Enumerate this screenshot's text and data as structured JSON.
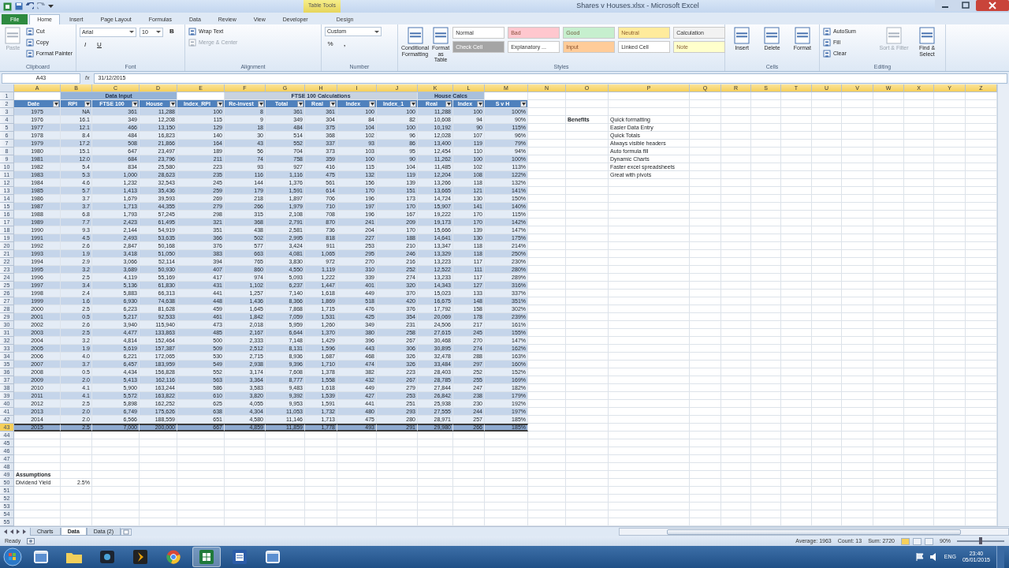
{
  "window": {
    "title": "Shares v Houses.xlsx - Microsoft Excel",
    "contextual_tab": "Table Tools"
  },
  "ribbon": {
    "tabs": [
      {
        "label": "File",
        "kind": "file",
        "selected": false
      },
      {
        "label": "Home",
        "kind": "tab",
        "selected": true
      },
      {
        "label": "Insert",
        "kind": "tab",
        "selected": false
      },
      {
        "label": "Page Layout",
        "kind": "tab",
        "selected": false
      },
      {
        "label": "Formulas",
        "kind": "tab",
        "selected": false
      },
      {
        "label": "Data",
        "kind": "tab",
        "selected": false
      },
      {
        "label": "Review",
        "kind": "tab",
        "selected": false
      },
      {
        "label": "View",
        "kind": "tab",
        "selected": false
      },
      {
        "label": "Developer",
        "kind": "tab",
        "selected": false
      },
      {
        "label": "Design",
        "kind": "contextual",
        "selected": false
      }
    ],
    "groups": [
      {
        "label": "Clipboard",
        "items": [
          {
            "kind": "large",
            "label": "Paste",
            "disabled": true
          },
          {
            "kind": "small",
            "label": "Cut",
            "disabled": false
          },
          {
            "kind": "small",
            "label": "Copy",
            "disabled": false
          },
          {
            "kind": "small",
            "label": "Format Painter",
            "disabled": false
          }
        ]
      },
      {
        "label": "Font",
        "items": [
          {
            "kind": "field",
            "label": "Arial"
          },
          {
            "kind": "field",
            "label": "10"
          },
          {
            "kind": "glyph",
            "label": "B"
          },
          {
            "kind": "glyph",
            "label": "I"
          },
          {
            "kind": "glyph",
            "label": "U"
          }
        ]
      },
      {
        "label": "Alignment",
        "items": [
          {
            "kind": "small",
            "label": "Wrap Text",
            "disabled": false
          },
          {
            "kind": "small",
            "label": "Merge & Center",
            "disabled": true
          }
        ]
      },
      {
        "label": "Number",
        "items": [
          {
            "kind": "field",
            "label": "Custom"
          },
          {
            "kind": "glyph",
            "label": "%"
          },
          {
            "kind": "glyph",
            "label": ","
          }
        ]
      },
      {
        "label": "Styles",
        "items": [
          {
            "kind": "large",
            "label": "Conditional Formatting",
            "disabled": false
          },
          {
            "kind": "large",
            "label": "Format as Table",
            "disabled": false
          }
        ],
        "gallery": [
          {
            "kind": "style",
            "label": "Normal",
            "color": "#ffffff"
          },
          {
            "kind": "style",
            "label": "Bad",
            "color": "#ffc7ce"
          },
          {
            "kind": "style",
            "label": "Good",
            "color": "#c6efce"
          },
          {
            "kind": "style",
            "label": "Neutral",
            "color": "#ffeb9c"
          },
          {
            "kind": "style",
            "label": "Calculation",
            "color": "#f2f2f2"
          },
          {
            "kind": "style",
            "label": "Check Cell",
            "color": "#a5a5a5"
          },
          {
            "kind": "style",
            "label": "Explanatory ...",
            "color": "#ffffff"
          },
          {
            "kind": "style",
            "label": "Input",
            "color": "#ffcc99"
          },
          {
            "kind": "style",
            "label": "Linked Cell",
            "color": "#ffffff"
          },
          {
            "kind": "style",
            "label": "Note",
            "color": "#ffffcc"
          }
        ]
      },
      {
        "label": "Cells",
        "items": [
          {
            "kind": "large",
            "label": "Insert",
            "disabled": false
          },
          {
            "kind": "large",
            "label": "Delete",
            "disabled": false
          },
          {
            "kind": "large",
            "label": "Format",
            "disabled": false
          }
        ]
      },
      {
        "label": "Editing",
        "items": [
          {
            "kind": "small",
            "label": "AutoSum",
            "disabled": false
          },
          {
            "kind": "small",
            "label": "Fill",
            "disabled": false
          },
          {
            "kind": "small",
            "label": "Clear",
            "disabled": false
          },
          {
            "kind": "large",
            "label": "Sort & Filter",
            "disabled": true
          },
          {
            "kind": "large",
            "label": "Find & Select",
            "disabled": false
          }
        ]
      }
    ]
  },
  "formula_bar": {
    "name_box": "A43",
    "fx": "fx",
    "value": "31/12/2015"
  },
  "sheet": {
    "column_headers": [
      "A",
      "B",
      "C",
      "D",
      "E",
      "F",
      "G",
      "H",
      "I",
      "J",
      "K",
      "L",
      "M",
      "N",
      "O",
      "P",
      "Q",
      "R",
      "S",
      "T",
      "U",
      "V",
      "W",
      "X",
      "Y",
      "Z"
    ],
    "row_headers": [
      "1",
      "2",
      "3",
      "4",
      "5",
      "6",
      "7",
      "8",
      "9",
      "10",
      "11",
      "12",
      "13",
      "14",
      "15",
      "16",
      "17",
      "18",
      "19",
      "20",
      "21",
      "22",
      "23",
      "24",
      "25",
      "26",
      "27",
      "28",
      "29",
      "30",
      "31",
      "32",
      "33",
      "34",
      "35",
      "36",
      "37",
      "38",
      "39",
      "40",
      "41",
      "42",
      "43",
      "44",
      "45",
      "46",
      "47",
      "48",
      "49",
      "50",
      "51",
      "52",
      "53",
      "54",
      "55"
    ],
    "table": {
      "groups": [
        {
          "label": "Data Input",
          "color": "#95b3d7"
        },
        {
          "label": "FTSE 100 Calculations",
          "color": "#c9d3e0"
        },
        {
          "label": "House Calcs",
          "color": "#a9c0dc"
        }
      ],
      "columns": [
        "Date",
        "RPI",
        "FTSE 100",
        "House",
        "Index_RPI",
        "Re-invest",
        "Total",
        "Real",
        "Index",
        "Index_1",
        "Real",
        "Index",
        "S v H"
      ],
      "rows": [
        {
          "selected": false,
          "cells": [
            "1975",
            "NA",
            "361",
            "11,288",
            "100",
            "8",
            "361",
            "361",
            "100",
            "100",
            "11,288",
            "100",
            "100%"
          ]
        },
        {
          "selected": false,
          "cells": [
            "1976",
            "16.1",
            "349",
            "12,208",
            "115",
            "9",
            "349",
            "304",
            "84",
            "82",
            "10,608",
            "94",
            "90%"
          ]
        },
        {
          "selected": false,
          "cells": [
            "1977",
            "12.1",
            "466",
            "13,150",
            "129",
            "18",
            "484",
            "375",
            "104",
            "100",
            "10,192",
            "90",
            "115%"
          ]
        },
        {
          "selected": false,
          "cells": [
            "1978",
            "8.4",
            "484",
            "16,823",
            "140",
            "30",
            "514",
            "368",
            "102",
            "96",
            "12,028",
            "107",
            "96%"
          ]
        },
        {
          "selected": false,
          "cells": [
            "1979",
            "17.2",
            "508",
            "21,866",
            "164",
            "43",
            "552",
            "337",
            "93",
            "86",
            "13,400",
            "119",
            "79%"
          ]
        },
        {
          "selected": false,
          "cells": [
            "1980",
            "15.1",
            "647",
            "23,497",
            "189",
            "56",
            "704",
            "373",
            "103",
            "95",
            "12,454",
            "110",
            "94%"
          ]
        },
        {
          "selected": false,
          "cells": [
            "1981",
            "12.0",
            "684",
            "23,796",
            "211",
            "74",
            "758",
            "359",
            "100",
            "90",
            "11,262",
            "100",
            "100%"
          ]
        },
        {
          "selected": false,
          "cells": [
            "1982",
            "5.4",
            "834",
            "25,580",
            "223",
            "93",
            "927",
            "416",
            "115",
            "104",
            "11,485",
            "102",
            "113%"
          ]
        },
        {
          "selected": false,
          "cells": [
            "1983",
            "5.3",
            "1,000",
            "28,623",
            "235",
            "116",
            "1,116",
            "475",
            "132",
            "119",
            "12,204",
            "108",
            "122%"
          ]
        },
        {
          "selected": false,
          "cells": [
            "1984",
            "4.6",
            "1,232",
            "32,543",
            "245",
            "144",
            "1,376",
            "561",
            "156",
            "139",
            "13,266",
            "118",
            "132%"
          ]
        },
        {
          "selected": false,
          "cells": [
            "1985",
            "5.7",
            "1,413",
            "35,436",
            "259",
            "179",
            "1,591",
            "614",
            "170",
            "151",
            "13,665",
            "121",
            "141%"
          ]
        },
        {
          "selected": false,
          "cells": [
            "1986",
            "3.7",
            "1,679",
            "39,593",
            "269",
            "218",
            "1,897",
            "706",
            "196",
            "173",
            "14,724",
            "130",
            "150%"
          ]
        },
        {
          "selected": false,
          "cells": [
            "1987",
            "3.7",
            "1,713",
            "44,355",
            "279",
            "266",
            "1,979",
            "710",
            "197",
            "170",
            "15,907",
            "141",
            "140%"
          ]
        },
        {
          "selected": false,
          "cells": [
            "1988",
            "6.8",
            "1,793",
            "57,245",
            "298",
            "315",
            "2,108",
            "708",
            "196",
            "167",
            "19,222",
            "170",
            "115%"
          ]
        },
        {
          "selected": false,
          "cells": [
            "1989",
            "7.7",
            "2,423",
            "61,495",
            "321",
            "368",
            "2,791",
            "870",
            "241",
            "209",
            "19,173",
            "170",
            "142%"
          ]
        },
        {
          "selected": false,
          "cells": [
            "1990",
            "9.3",
            "2,144",
            "54,919",
            "351",
            "438",
            "2,581",
            "736",
            "204",
            "170",
            "15,666",
            "139",
            "147%"
          ]
        },
        {
          "selected": false,
          "cells": [
            "1991",
            "4.5",
            "2,493",
            "53,635",
            "366",
            "502",
            "2,995",
            "818",
            "227",
            "188",
            "14,641",
            "130",
            "175%"
          ]
        },
        {
          "selected": false,
          "cells": [
            "1992",
            "2.6",
            "2,847",
            "50,168",
            "376",
            "577",
            "3,424",
            "911",
            "253",
            "210",
            "13,347",
            "118",
            "214%"
          ]
        },
        {
          "selected": false,
          "cells": [
            "1993",
            "1.9",
            "3,418",
            "51,050",
            "383",
            "663",
            "4,081",
            "1,065",
            "295",
            "246",
            "13,329",
            "118",
            "250%"
          ]
        },
        {
          "selected": false,
          "cells": [
            "1994",
            "2.9",
            "3,066",
            "52,114",
            "394",
            "765",
            "3,830",
            "972",
            "270",
            "216",
            "13,223",
            "117",
            "230%"
          ]
        },
        {
          "selected": false,
          "cells": [
            "1995",
            "3.2",
            "3,689",
            "50,930",
            "407",
            "860",
            "4,550",
            "1,119",
            "310",
            "252",
            "12,522",
            "111",
            "280%"
          ]
        },
        {
          "selected": false,
          "cells": [
            "1996",
            "2.5",
            "4,119",
            "55,169",
            "417",
            "974",
            "5,093",
            "1,222",
            "339",
            "274",
            "13,233",
            "117",
            "289%"
          ]
        },
        {
          "selected": false,
          "cells": [
            "1997",
            "3.4",
            "5,136",
            "61,830",
            "431",
            "1,102",
            "6,237",
            "1,447",
            "401",
            "320",
            "14,343",
            "127",
            "316%"
          ]
        },
        {
          "selected": false,
          "cells": [
            "1998",
            "2.4",
            "5,883",
            "66,313",
            "441",
            "1,257",
            "7,140",
            "1,618",
            "449",
            "370",
            "15,023",
            "133",
            "337%"
          ]
        },
        {
          "selected": false,
          "cells": [
            "1999",
            "1.6",
            "6,930",
            "74,638",
            "448",
            "1,436",
            "8,366",
            "1,869",
            "518",
            "420",
            "16,675",
            "148",
            "351%"
          ]
        },
        {
          "selected": false,
          "cells": [
            "2000",
            "2.5",
            "6,223",
            "81,628",
            "459",
            "1,645",
            "7,868",
            "1,715",
            "476",
            "376",
            "17,792",
            "158",
            "302%"
          ]
        },
        {
          "selected": false,
          "cells": [
            "2001",
            "0.5",
            "5,217",
            "92,533",
            "461",
            "1,842",
            "7,059",
            "1,531",
            "425",
            "354",
            "20,069",
            "178",
            "239%"
          ]
        },
        {
          "selected": false,
          "cells": [
            "2002",
            "2.6",
            "3,940",
            "115,940",
            "473",
            "2,018",
            "5,959",
            "1,260",
            "349",
            "231",
            "24,506",
            "217",
            "161%"
          ]
        },
        {
          "selected": false,
          "cells": [
            "2003",
            "2.5",
            "4,477",
            "133,863",
            "485",
            "2,167",
            "6,644",
            "1,370",
            "380",
            "258",
            "27,615",
            "245",
            "155%"
          ]
        },
        {
          "selected": false,
          "cells": [
            "2004",
            "3.2",
            "4,814",
            "152,464",
            "500",
            "2,333",
            "7,148",
            "1,429",
            "396",
            "267",
            "30,468",
            "270",
            "147%"
          ]
        },
        {
          "selected": false,
          "cells": [
            "2005",
            "1.9",
            "5,619",
            "157,387",
            "509",
            "2,512",
            "8,131",
            "1,596",
            "443",
            "306",
            "30,895",
            "274",
            "162%"
          ]
        },
        {
          "selected": false,
          "cells": [
            "2006",
            "4.0",
            "6,221",
            "172,065",
            "530",
            "2,715",
            "8,936",
            "1,687",
            "468",
            "326",
            "32,478",
            "288",
            "163%"
          ]
        },
        {
          "selected": false,
          "cells": [
            "2007",
            "3.7",
            "6,457",
            "183,959",
            "549",
            "2,938",
            "9,396",
            "1,710",
            "474",
            "326",
            "33,484",
            "297",
            "160%"
          ]
        },
        {
          "selected": false,
          "cells": [
            "2008",
            "0.5",
            "4,434",
            "156,828",
            "552",
            "3,174",
            "7,608",
            "1,378",
            "382",
            "223",
            "28,403",
            "252",
            "152%"
          ]
        },
        {
          "selected": false,
          "cells": [
            "2009",
            "2.0",
            "5,413",
            "162,116",
            "563",
            "3,364",
            "8,777",
            "1,558",
            "432",
            "267",
            "28,785",
            "255",
            "169%"
          ]
        },
        {
          "selected": false,
          "cells": [
            "2010",
            "4.1",
            "5,900",
            "163,244",
            "586",
            "3,583",
            "9,483",
            "1,618",
            "449",
            "279",
            "27,844",
            "247",
            "182%"
          ]
        },
        {
          "selected": false,
          "cells": [
            "2011",
            "4.1",
            "5,572",
            "163,822",
            "610",
            "3,820",
            "9,392",
            "1,539",
            "427",
            "253",
            "26,842",
            "238",
            "179%"
          ]
        },
        {
          "selected": false,
          "cells": [
            "2012",
            "2.5",
            "5,898",
            "162,252",
            "625",
            "4,055",
            "9,953",
            "1,591",
            "441",
            "251",
            "25,938",
            "230",
            "192%"
          ]
        },
        {
          "selected": false,
          "cells": [
            "2013",
            "2.0",
            "6,749",
            "175,626",
            "638",
            "4,304",
            "11,053",
            "1,732",
            "480",
            "293",
            "27,555",
            "244",
            "197%"
          ]
        },
        {
          "selected": false,
          "cells": [
            "2014",
            "2.0",
            "6,566",
            "188,559",
            "651",
            "4,580",
            "11,146",
            "1,713",
            "475",
            "280",
            "28,971",
            "257",
            "185%"
          ]
        },
        {
          "selected": true,
          "cells": [
            "2015",
            "2.5",
            "7,000",
            "200,000",
            "667",
            "4,859",
            "11,859",
            "1,778",
            "493",
            "291",
            "29,980",
            "266",
            "185%"
          ]
        }
      ]
    },
    "benefits": {
      "title": "Benefits",
      "items": [
        "Quick formatting",
        "Easier Data Entry",
        "Quick Totals",
        "Always visible headers",
        "Auto formula fill",
        "Dynamic Charts",
        "Faster excel spreadsheets",
        "Great with pivots"
      ]
    },
    "assumptions": {
      "title": "Assumptions",
      "label": "Dividend Yield",
      "value": "2.5%"
    }
  },
  "sheet_tabs": [
    {
      "label": "Charts",
      "selected": false
    },
    {
      "label": "Data",
      "selected": true
    },
    {
      "label": "Data (2)",
      "selected": false
    }
  ],
  "status_bar": {
    "mode": "Ready",
    "average": "Average: 1963",
    "count": "Count: 13",
    "sum": "Sum: 2720",
    "zoom": "90%",
    "zoom_slider": {
      "level": 0.5
    }
  },
  "taskbar": {
    "apps": [
      {
        "kind": "window",
        "active": false
      },
      {
        "kind": "folder",
        "active": false
      },
      {
        "kind": "media",
        "active": false
      },
      {
        "kind": "chevron",
        "active": false
      },
      {
        "kind": "browser",
        "active": false
      },
      {
        "kind": "spreadsheet",
        "active": true
      },
      {
        "kind": "document",
        "active": false
      },
      {
        "kind": "window",
        "active": false
      }
    ],
    "language": "ENG",
    "time": "23:40",
    "date": "05/01/2015"
  }
}
